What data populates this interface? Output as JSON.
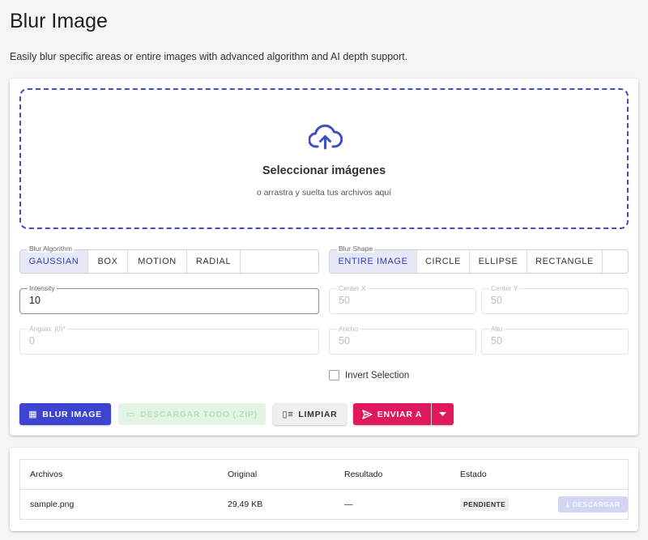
{
  "header": {
    "title": "Blur Image",
    "description": "Easily blur specific areas or entire images with advanced algorithm and AI depth support."
  },
  "dropzone": {
    "icon": "cloud-upload-icon",
    "title": "Seleccionar imágenes",
    "subtitle": "o arrastra y suelta tus archivos aquí"
  },
  "algorithm": {
    "legend": "Blur Algorithm",
    "options": [
      "GAUSSIAN",
      "BOX",
      "MOTION",
      "RADIAL"
    ],
    "selected": "GAUSSIAN"
  },
  "shape": {
    "legend": "Blur Shape",
    "options": [
      "ENTIRE IMAGE",
      "CIRCLE",
      "ELLIPSE",
      "RECTANGLE"
    ],
    "selected": "ENTIRE IMAGE"
  },
  "fields": {
    "intensity": {
      "label": "Intensity",
      "value": "10"
    },
    "center_x": {
      "label": "Center X",
      "value": "50"
    },
    "center_y": {
      "label": "Center Y",
      "value": "50"
    },
    "angle": {
      "label": "Ángulo: (0)*",
      "value": "0"
    },
    "width": {
      "label": "Ancho",
      "value": "50"
    },
    "height": {
      "label": "Alto",
      "value": "50"
    }
  },
  "invert_selection": {
    "label": "Invert Selection",
    "checked": false
  },
  "actions": {
    "blur": "BLUR IMAGE",
    "download_all": "DESCARGAR TODO (.ZIP)",
    "clear": "LIMPIAR",
    "send": "ENVIAR A"
  },
  "table": {
    "headers": [
      "Archivos",
      "Original",
      "Resultado",
      "Estado"
    ],
    "rows": [
      {
        "file": "sample.png",
        "original": "29,49 KB",
        "result": "—",
        "status": "PENDIENTE",
        "action": "DESCARGAR"
      }
    ]
  },
  "colors": {
    "primary": "#3d44cf",
    "accent": "#e0185d",
    "dropzone_border": "#3f4fbf"
  }
}
